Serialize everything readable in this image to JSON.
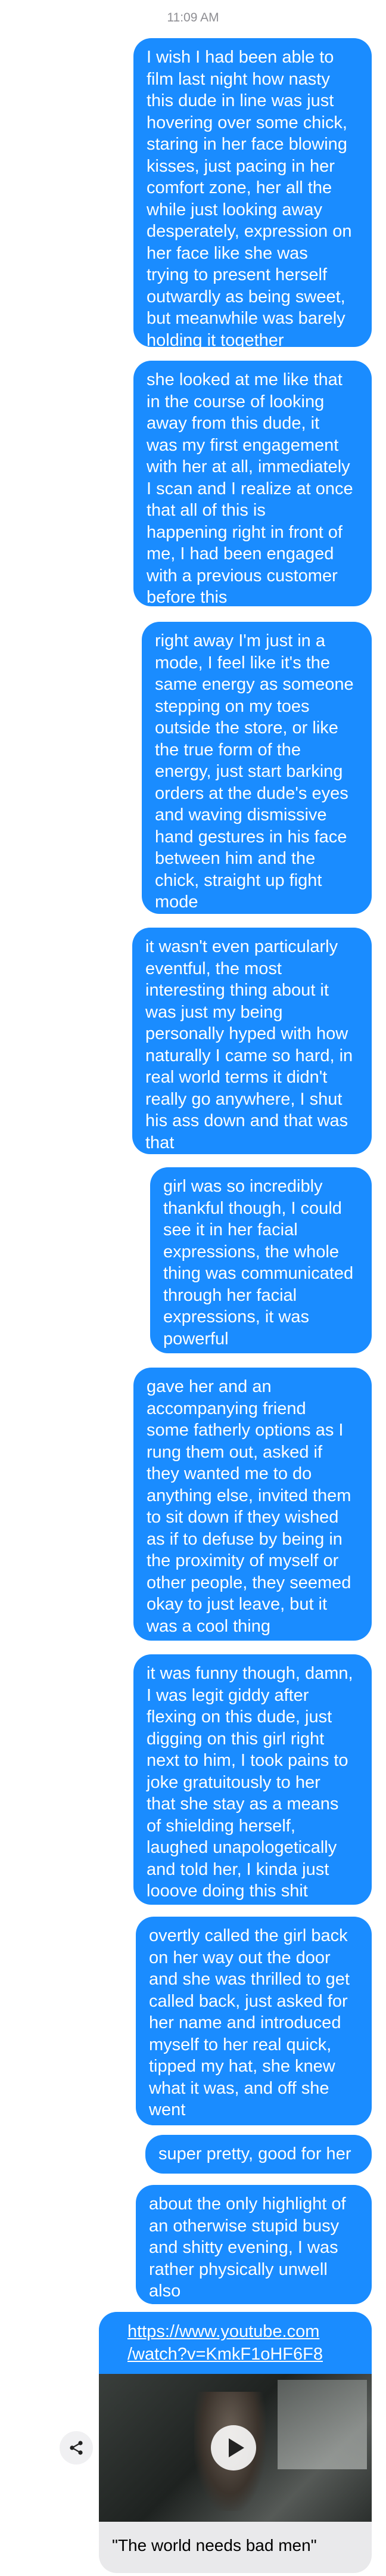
{
  "status": {
    "time": "11:09 AM"
  },
  "messages": [
    {
      "lines": [
        "I wish I had been able to",
        "film last night how nasty",
        "this dude in line was just",
        "hovering over some chick,",
        "staring in her face blowing",
        "kisses, just pacing in her",
        "comfort zone, her all the",
        "while just looking away",
        "desperately, expression on",
        "her face like she was",
        "trying to present herself",
        "outwardly as being sweet,",
        "but meanwhile was barely",
        "holding it together"
      ]
    },
    {
      "lines": [
        "she looked at me like that",
        "in the course of looking",
        "away from this dude, it",
        "was my first engagement",
        "with her at all, immediately",
        "I scan and I realize at once",
        "that all of this is",
        "happening right in front of",
        "me, I had been engaged",
        "with a previous customer",
        "before this"
      ]
    },
    {
      "lines": [
        "right away I'm just in a",
        "mode, I feel like it's the",
        "same energy as someone",
        "stepping on my toes",
        "outside the store, or like",
        "the true form of the",
        "energy, just start barking",
        "orders at the dude's eyes",
        "and waving dismissive",
        "hand gestures in his face",
        "between him and the",
        "chick, straight up fight",
        "mode"
      ]
    },
    {
      "lines": [
        "it wasn't even particularly",
        "eventful, the most",
        "interesting thing about it",
        "was just my being",
        "personally hyped with how",
        "naturally I came so hard, in",
        "real world terms it didn't",
        "really go anywhere, I shut",
        "his ass down and that was",
        "that"
      ]
    },
    {
      "lines": [
        "girl was so incredibly",
        "thankful though, I could",
        "see it in her facial",
        "expressions, the whole",
        "thing was communicated",
        "through her facial",
        "expressions, it was",
        "powerful"
      ]
    },
    {
      "lines": [
        "gave her and an",
        "accompanying friend",
        "some fatherly options as I",
        "rung them out, asked if",
        "they wanted me to do",
        "anything else, invited them",
        "to sit down if they wished",
        "as if to defuse by being in",
        "the proximity of myself or",
        "other people, they seemed",
        "okay to just leave, but it",
        "was a cool thing"
      ]
    },
    {
      "lines": [
        "it was funny though, damn,",
        "I was legit giddy after",
        "flexing on this dude, just",
        "digging on this girl right",
        "next to him, I took pains to",
        "joke gratuitously to her",
        "that she stay as a means",
        "of shielding herself,",
        "laughed unapologetically",
        "and told her, I kinda just",
        "looove doing this shit"
      ]
    },
    {
      "lines": [
        "overtly called the girl back",
        "on her way out the door",
        "and she was thrilled to get",
        "called back, just asked for",
        "her name and introduced",
        "myself to her real quick,",
        "tipped my hat, she knew",
        "what it was, and off she",
        "went"
      ]
    },
    {
      "lines": [
        "super pretty, good for her"
      ]
    },
    {
      "lines": [
        "about the only highlight of",
        "an otherwise stupid busy",
        "and shitty evening, I was",
        "rather physically unwell",
        "also"
      ]
    }
  ],
  "link_preview": {
    "url_line1": "https://www.youtube.com",
    "url_line2": "/watch?v=KmkF1oHF6F8",
    "title": "\"The world needs bad men\"",
    "thumbnail_icon": "play-icon"
  },
  "share": {
    "icon": "share-icon"
  },
  "colors": {
    "bubble": "#1a8cff",
    "bubble_text": "#ffffff",
    "timestamp": "#8e8e93"
  }
}
